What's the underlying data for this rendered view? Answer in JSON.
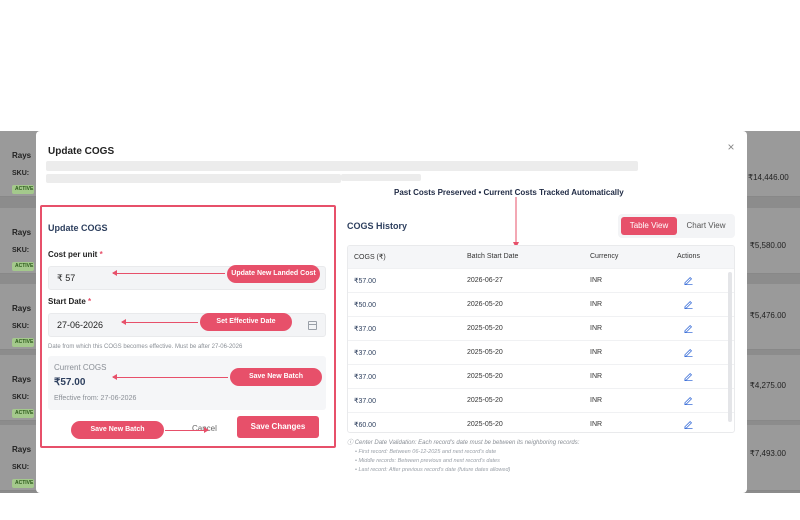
{
  "background_rows": [
    {
      "name": "Rays",
      "sku": "SKU:",
      "badge": "ACTIVE",
      "price": "₹14,446.00"
    },
    {
      "name": "Rays",
      "sku": "SKU:",
      "badge": "ACTIVE",
      "price": "₹5,580.00"
    },
    {
      "name": "Rays",
      "sku": "SKU:",
      "badge": "ACTIVE",
      "price": "₹5,476.00"
    },
    {
      "name": "Rays",
      "sku": "SKU:",
      "badge": "ACTIVE",
      "price": "₹4,275.00"
    },
    {
      "name": "Rays",
      "sku": "SKU:",
      "badge": "ACTIVE",
      "price": "₹7,493.00"
    }
  ],
  "modal": {
    "title": "Update COGS",
    "close_icon": "×",
    "tagline": "Past Costs Preserved • Current Costs Tracked Automatically"
  },
  "form": {
    "title": "Update COGS",
    "cost_label": "Cost per unit",
    "required_mark": "*",
    "cost_value": "₹ 57",
    "date_label": "Start Date",
    "date_value": "27-06-2026",
    "date_hint": "Date from which this COGS becomes effective. Must be after 27-06-2026",
    "current_label": "Current COGS",
    "current_value": "₹57.00",
    "current_from": "Effective from: 27-06-2026",
    "cancel_label": "Cancel",
    "save_label": "Save Changes"
  },
  "annotations": {
    "landed_cost": "Update New Landed Cost",
    "effective_date": "Set Effective Date",
    "save_batch_1": "Save New Batch",
    "save_batch_2": "Save New Batch"
  },
  "history": {
    "title": "COGS History",
    "table_view_label": "Table View",
    "chart_view_label": "Chart View",
    "columns": [
      "COGS (₹)",
      "Batch Start Date",
      "Currency",
      "Actions"
    ],
    "rows": [
      {
        "cogs": "₹57.00",
        "date": "2026-06-27",
        "currency": "INR"
      },
      {
        "cogs": "₹50.00",
        "date": "2026-05-20",
        "currency": "INR"
      },
      {
        "cogs": "₹37.00",
        "date": "2025-05-20",
        "currency": "INR"
      },
      {
        "cogs": "₹37.00",
        "date": "2025-05-20",
        "currency": "INR"
      },
      {
        "cogs": "₹37.00",
        "date": "2025-05-20",
        "currency": "INR"
      },
      {
        "cogs": "₹37.00",
        "date": "2025-05-20",
        "currency": "INR"
      },
      {
        "cogs": "₹60.00",
        "date": "2025-05-20",
        "currency": "INR"
      }
    ],
    "edit_icon": "pencil-icon"
  },
  "validation": {
    "title": "Center Date Validation: Each record's date must be between its neighboring records:",
    "items": [
      "First record: Between 06-12-2025 and next record's date",
      "Middle records: Between previous and next record's dates",
      "Last record: After previous record's date (future dates allowed)"
    ]
  },
  "colors": {
    "accent": "#e7506a",
    "heading": "#2d3f5e",
    "overlay": "#8c8c8c"
  }
}
